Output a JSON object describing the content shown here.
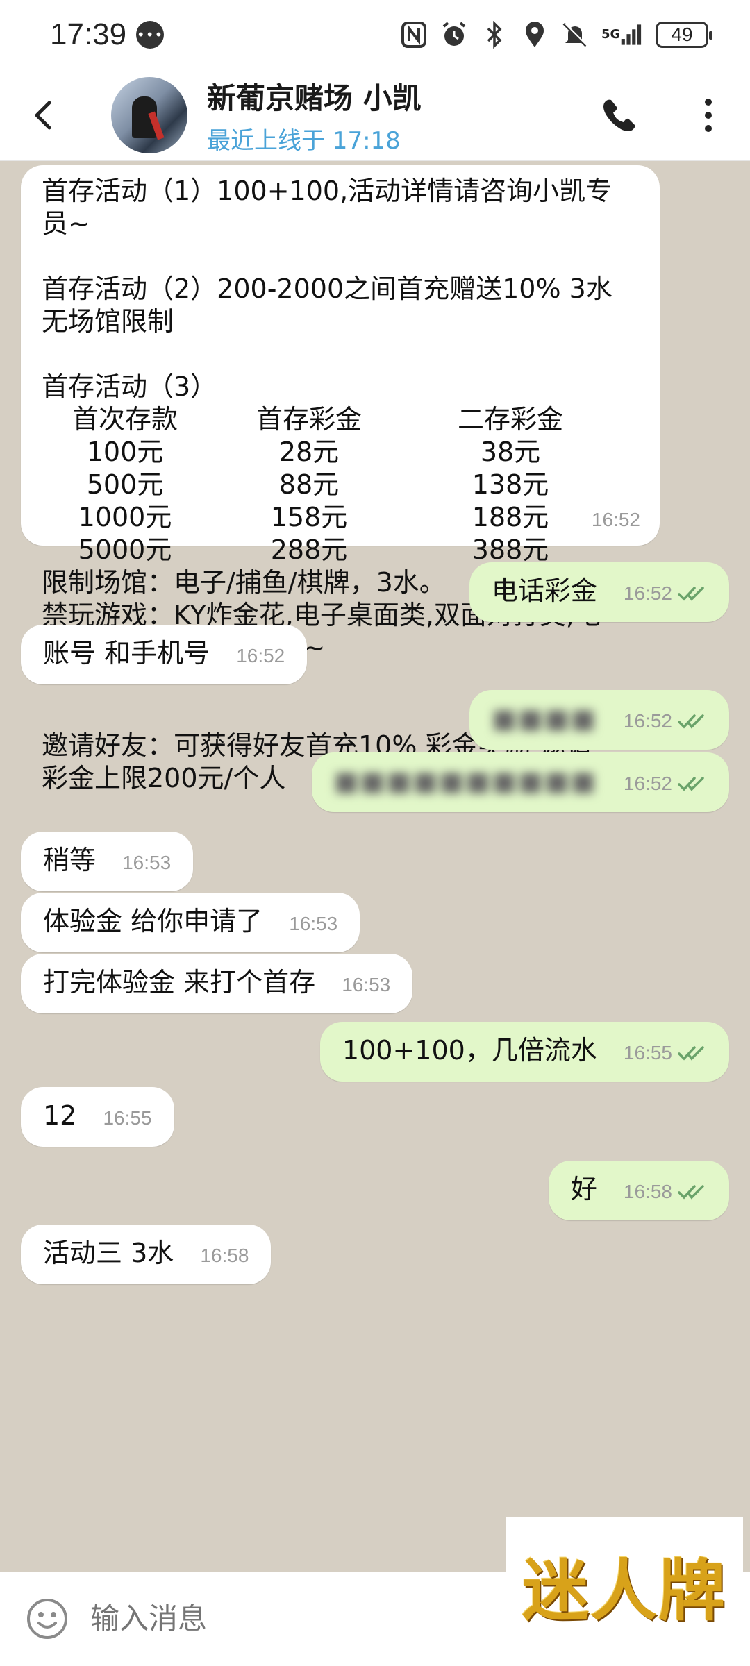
{
  "status_bar": {
    "time": "17:39",
    "battery": "49",
    "network": "5G"
  },
  "header": {
    "contact_name": "新葡京赌场 小凯",
    "last_seen": "最近上线于 17:18"
  },
  "messages": [
    {
      "direction": "in",
      "time": "16:52",
      "lines_top": "首存活动（1）100+100,活动详情请咨询小凯专\n员~\n\n首存活动（2）200-2000之间首充赠送10% 3水\n无场馆限制\n\n首存活动（3）",
      "table": [
        [
          "首次存款",
          "首存彩金",
          "二存彩金"
        ],
        [
          "100元",
          "28元",
          "38元"
        ],
        [
          "500元",
          "88元",
          "138元"
        ],
        [
          "1000元",
          "158元",
          "188元"
        ],
        [
          "5000元",
          "288元",
          "388元"
        ]
      ],
      "lines_bottom": "限制场馆：电子/捕鱼/棋牌，3水。\n禁玩游戏：KY炸金花,电子桌面类,双面对打类,电\n子21点,街机类,等游戏~\n\n\n邀请好友：可获得好友首充10% 彩金奖励 邀请\n彩金上限200元/个人"
    },
    {
      "direction": "out",
      "text": "电话彩金",
      "time": "16:52"
    },
    {
      "direction": "in",
      "text": "账号 和手机号",
      "time": "16:52"
    },
    {
      "direction": "out",
      "text": "■■■■",
      "time": "16:52",
      "blurred": true
    },
    {
      "direction": "out",
      "text": "■■■■■■■■■■",
      "time": "16:52",
      "blurred": true
    },
    {
      "direction": "in",
      "text": "稍等",
      "time": "16:53"
    },
    {
      "direction": "in",
      "text": "体验金 给你申请了",
      "time": "16:53"
    },
    {
      "direction": "in",
      "text": "打完体验金 来打个首存",
      "time": "16:53"
    },
    {
      "direction": "out",
      "text": "100+100，几倍流水",
      "time": "16:55"
    },
    {
      "direction": "in",
      "text": "12",
      "time": "16:55"
    },
    {
      "direction": "out",
      "text": "好",
      "time": "16:58"
    },
    {
      "direction": "in",
      "text": "活动三 3水",
      "time": "16:58"
    }
  ],
  "input": {
    "placeholder": "输入消息"
  },
  "watermark": "迷人牌",
  "colors": {
    "chat_background": "#d6cfc3",
    "incoming_bubble": "#ffffff",
    "outgoing_bubble": "#e2f7c9",
    "last_seen": "#4aa3d8",
    "read_checks": "#6aa36a"
  },
  "icons": [
    "back-arrow-icon",
    "phone-icon",
    "more-vert-icon",
    "emoji-icon",
    "double-check-icon",
    "chat-notification-icon",
    "nfc-icon",
    "alarm-icon",
    "bluetooth-icon",
    "location-icon",
    "mute-icon",
    "signal-icon",
    "battery-icon"
  ]
}
